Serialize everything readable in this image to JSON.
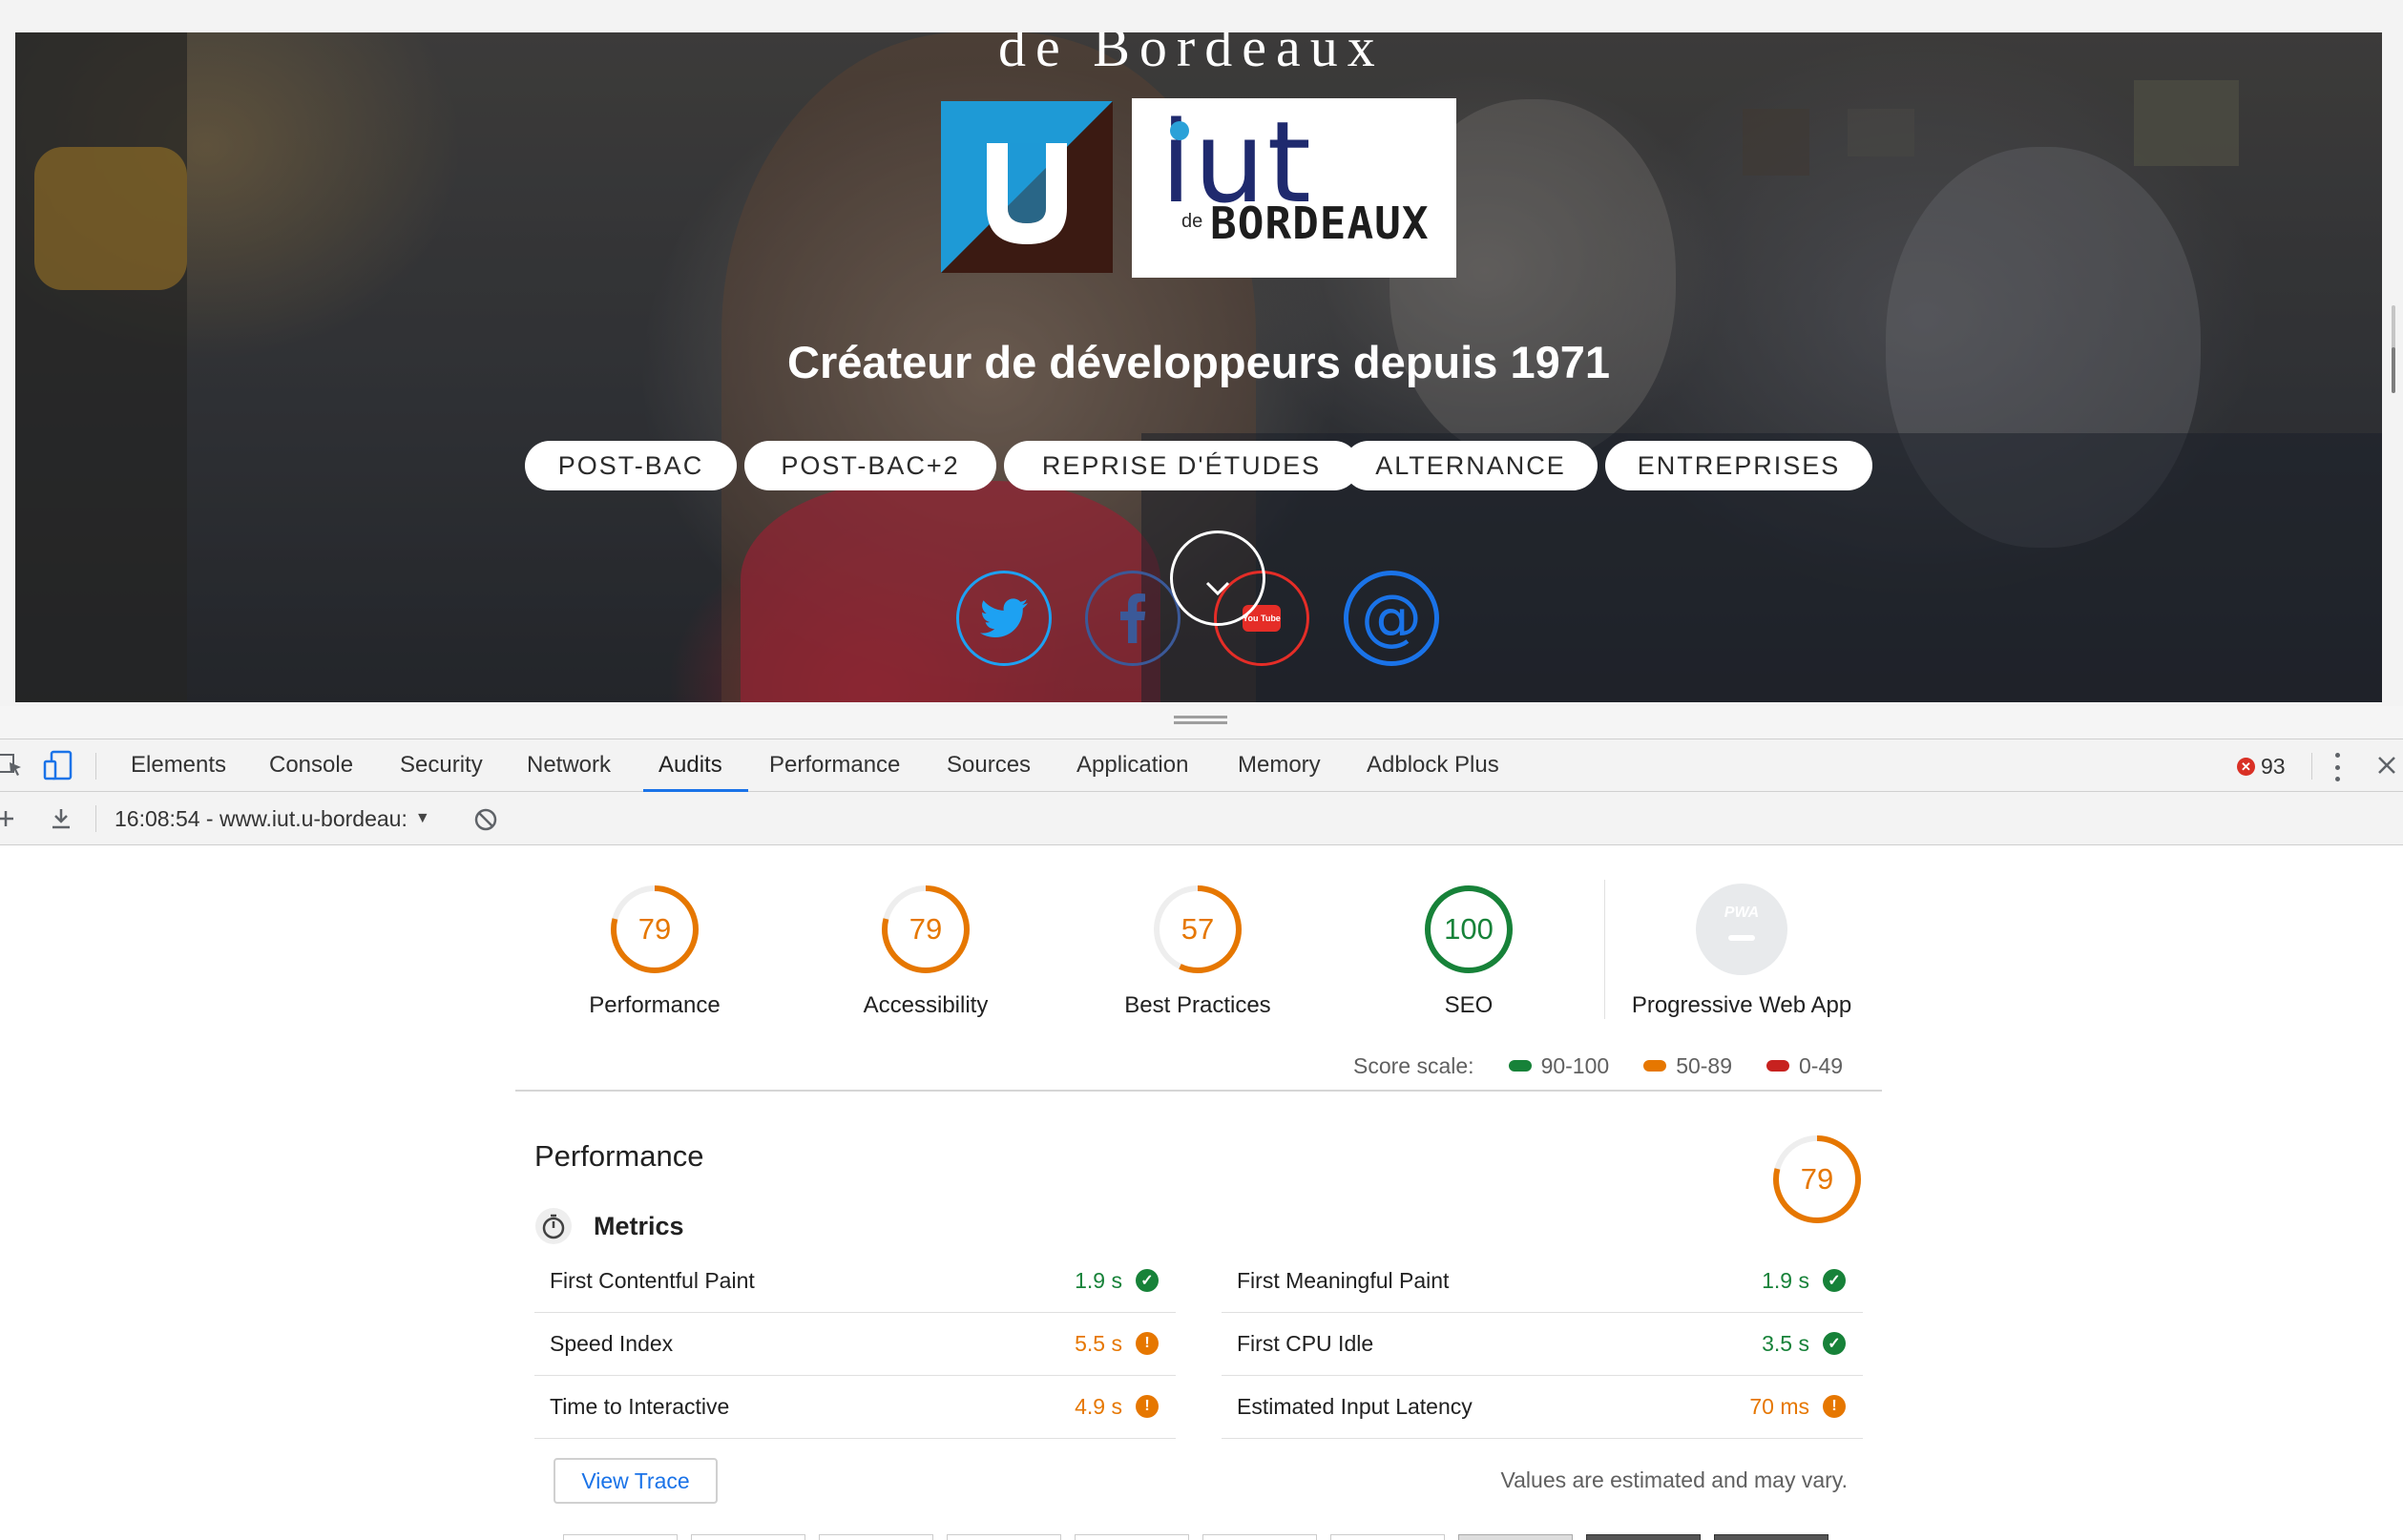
{
  "hero": {
    "cut_title": "de Bordeaux",
    "logo_iut_word": "iut",
    "logo_iut_de": "de",
    "logo_iut_city": "BORDEAUX",
    "tagline": "Créateur de développeurs depuis 1971",
    "pills": [
      "POST-BAC",
      "POST-BAC+2",
      "REPRISE D'ÉTUDES",
      "ALTERNANCE",
      "ENTREPRISES"
    ],
    "socials": [
      {
        "name": "twitter",
        "color": "#1da1f2"
      },
      {
        "name": "facebook",
        "color": "#3b5998"
      },
      {
        "name": "youtube",
        "color": "#e52d27"
      },
      {
        "name": "email",
        "color": "#1a73e8",
        "glyph": "@"
      }
    ],
    "youtube_text": "You Tube"
  },
  "devtools": {
    "tabs": [
      "Elements",
      "Console",
      "Security",
      "Network",
      "Audits",
      "Performance",
      "Sources",
      "Application",
      "Memory",
      "Adblock Plus"
    ],
    "active_tab": "Audits",
    "error_count": "93",
    "report_selector": "16:08:54 - www.iut.u-bordeau:"
  },
  "audits": {
    "categories": [
      {
        "label": "Performance",
        "score": "79",
        "value": 79,
        "color": "#e67700"
      },
      {
        "label": "Accessibility",
        "score": "79",
        "value": 79,
        "color": "#e67700"
      },
      {
        "label": "Best Practices",
        "score": "57",
        "value": 57,
        "color": "#e67700"
      },
      {
        "label": "SEO",
        "score": "100",
        "value": 100,
        "color": "#178239"
      },
      {
        "label": "Progressive Web App",
        "badge": "PWA"
      }
    ],
    "score_scale": {
      "label": "Score scale:",
      "ranges": [
        {
          "text": "90-100",
          "color": "#178239"
        },
        {
          "text": "50-89",
          "color": "#e67700"
        },
        {
          "text": "0-49",
          "color": "#c7221f"
        }
      ]
    },
    "performance": {
      "title": "Performance",
      "score": "79",
      "value": 79,
      "metrics_title": "Metrics",
      "metrics_left": [
        {
          "name": "First Contentful Paint",
          "value": "1.9 s",
          "status": "pass"
        },
        {
          "name": "Speed Index",
          "value": "5.5 s",
          "status": "average"
        },
        {
          "name": "Time to Interactive",
          "value": "4.9 s",
          "status": "average"
        }
      ],
      "metrics_right": [
        {
          "name": "First Meaningful Paint",
          "value": "1.9 s",
          "status": "pass"
        },
        {
          "name": "First CPU Idle",
          "value": "3.5 s",
          "status": "pass"
        },
        {
          "name": "Estimated Input Latency",
          "value": "70 ms",
          "status": "average"
        }
      ],
      "view_trace": "View Trace",
      "note": "Values are estimated and may vary."
    }
  }
}
